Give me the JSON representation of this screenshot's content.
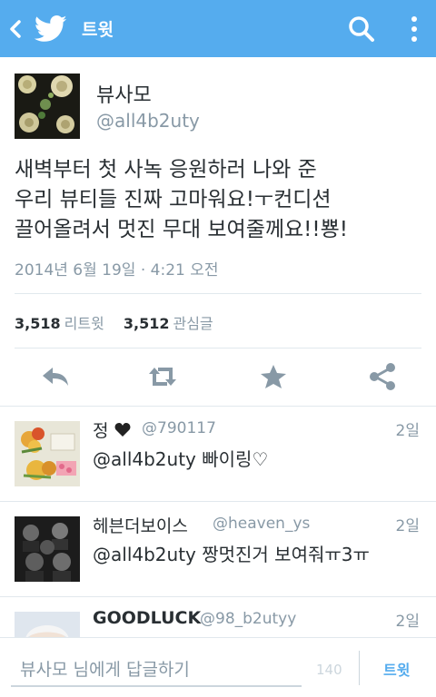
{
  "appbar": {
    "title": "트윗",
    "icons": [
      "back-icon",
      "twitter-bird-icon",
      "search-icon",
      "more-vert-icon"
    ],
    "color": "#55acee"
  },
  "tweet": {
    "name": "뷰사모",
    "handle": "@all4b2uty",
    "lines": [
      "새벽부터 첫 사녹 응원하러 나와 준",
      "우리 뷰티들 진짜 고마워요!ㅜ컨디션",
      "끌어올려서 멋진 무대 보여줄께요!!뿅!"
    ],
    "date": "2014년 6월 19일 · 4:21 오전",
    "retweets": "3,518",
    "retweets_label": "리트윗",
    "favorites": "3,512",
    "favorites_label": "관심글",
    "actions": [
      "reply-icon",
      "retweet-icon",
      "favorite-icon",
      "share-icon"
    ]
  },
  "replies": [
    {
      "name": "정",
      "has_heart": true,
      "handle": "@790117",
      "time": "2일",
      "text": "@all4b2uty 빠이링♡"
    },
    {
      "name": "헤븐더보이스",
      "handle": "@heaven_ys",
      "time": "2일",
      "text": "@all4b2uty 짱멋진거 보여줘ㅠ3ㅠ"
    },
    {
      "name": "GOODLUCK",
      "handle": "@98_b2utyy",
      "time": "2일",
      "text": ""
    }
  ],
  "composer": {
    "placeholder": "뷰사모 님에게 답글하기",
    "count": "140",
    "send_label": "트윗"
  }
}
